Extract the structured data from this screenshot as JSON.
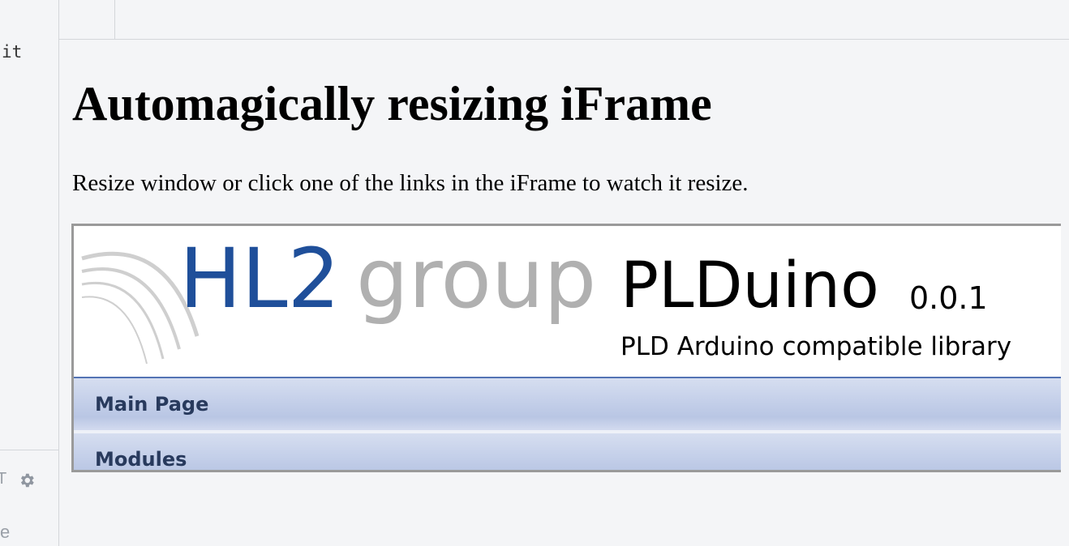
{
  "editor": {
    "code_fragment": "it",
    "settings_label_fragment": "T",
    "footer_fragment": "e"
  },
  "result": {
    "title": "Automagically resizing iFrame",
    "instruction": "Resize window or click one of the links in the iFrame to watch it resize."
  },
  "iframe": {
    "logo": {
      "primary": "HL2",
      "secondary": "group"
    },
    "project_name": "PLDuino",
    "project_number": "0.0.1",
    "project_brief": "PLD Arduino compatible library",
    "nav_items": [
      {
        "label": "Main Page"
      },
      {
        "label": "Modules"
      }
    ]
  },
  "colors": {
    "logo_blue": "#1f4f9a",
    "logo_gray": "#b0b0b0",
    "nav_text": "#283a5d",
    "header_rule": "#5373b4"
  }
}
